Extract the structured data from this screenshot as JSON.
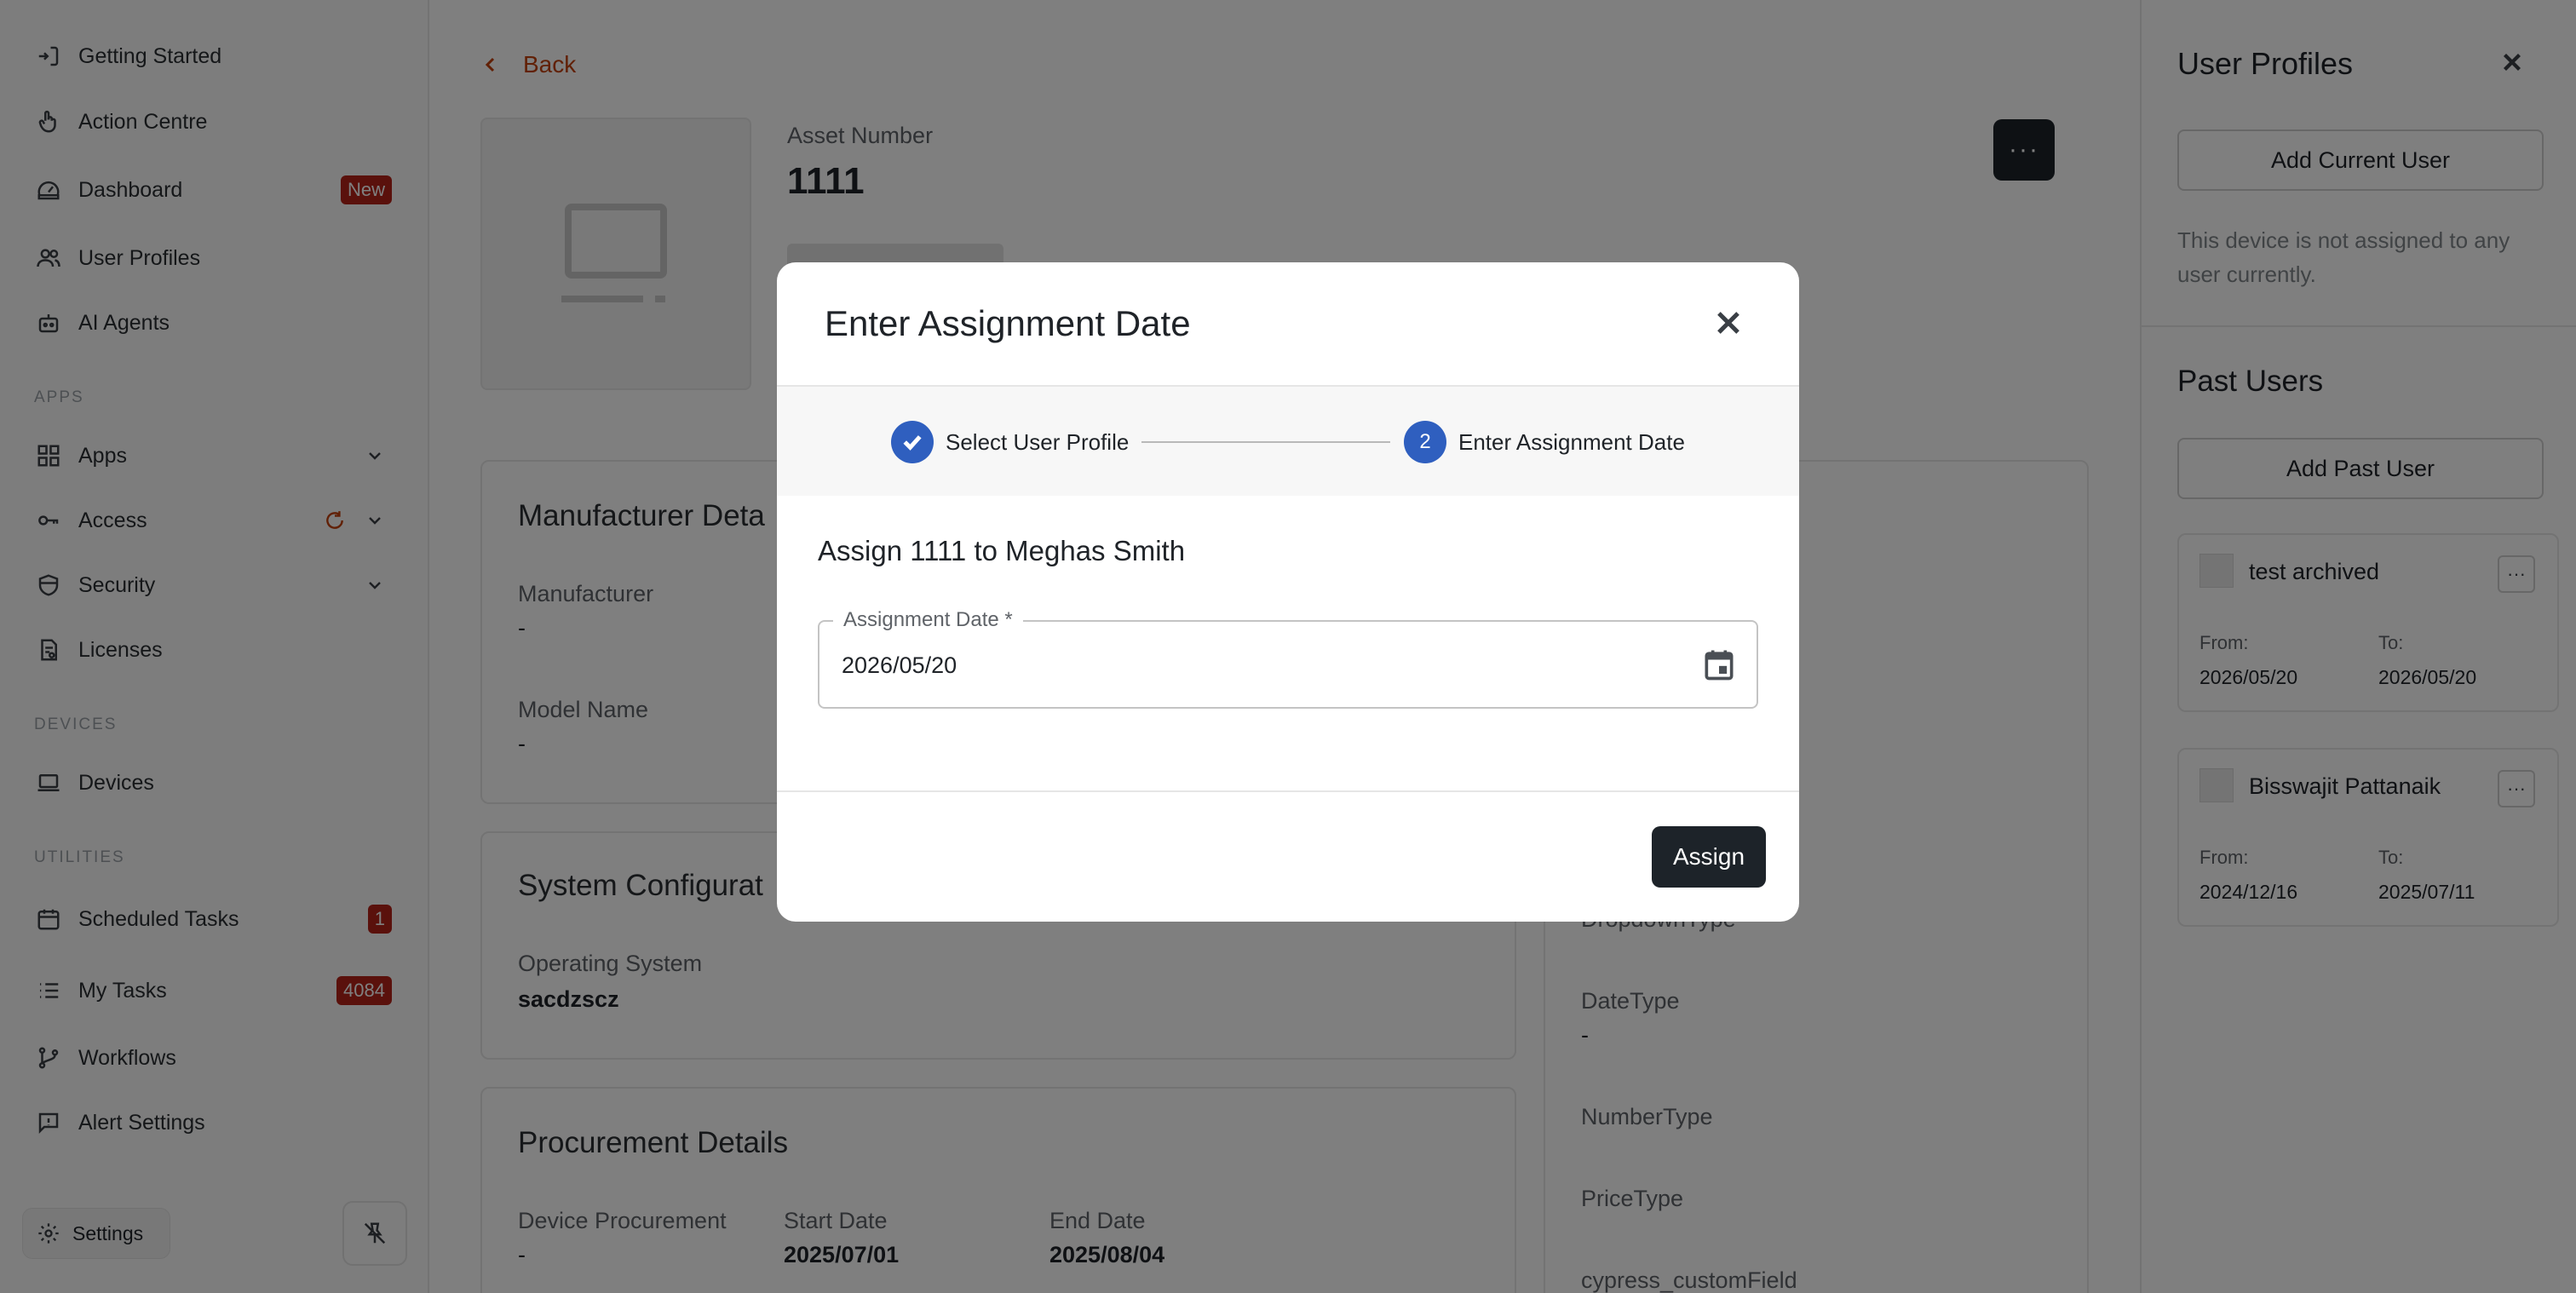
{
  "sidebar": {
    "items": [
      {
        "label": "Getting Started"
      },
      {
        "label": "Action Centre"
      },
      {
        "label": "Dashboard",
        "badge": "New"
      },
      {
        "label": "User Profiles"
      },
      {
        "label": "AI Agents"
      },
      {
        "label": "Apps"
      },
      {
        "label": "Access"
      },
      {
        "label": "Security"
      },
      {
        "label": "Licenses"
      },
      {
        "label": "Devices"
      },
      {
        "label": "Scheduled Tasks",
        "badge": "1"
      },
      {
        "label": "My Tasks",
        "badge": "4084"
      },
      {
        "label": "Workflows"
      },
      {
        "label": "Alert Settings"
      }
    ],
    "sections": {
      "apps": "APPS",
      "devices": "DEVICES",
      "utilities": "UTILITIES"
    },
    "settings_label": "Settings"
  },
  "main": {
    "back_label": "Back",
    "asset_label": "Asset Number",
    "asset_value": "1111",
    "more_label": "···",
    "manufacturer": {
      "title": "Manufacturer Deta",
      "manufacturer_label": "Manufacturer",
      "manufacturer_value": "-",
      "model_label": "Model Name",
      "model_value": "-"
    },
    "system": {
      "title": "System Configurat",
      "os_label": "Operating System",
      "os_value": "sacdzscz"
    },
    "procurement": {
      "title": "Procurement Details",
      "device_label": "Device Procurement",
      "device_value": "-",
      "start_label": "Start Date",
      "start_value": "2025/07/01",
      "end_label": "End Date",
      "end_value": "2025/08/04"
    },
    "custom": {
      "dropdown_label": "DropdownType",
      "date_label": "DateType",
      "date_value": "-",
      "number_label": "NumberType",
      "price_label": "PriceType",
      "cypress_label": "cypress_customField"
    }
  },
  "right_panel": {
    "title": "User Profiles",
    "add_current_label": "Add Current User",
    "note": "This device is not assigned to any user currently.",
    "past_title": "Past Users",
    "add_past_label": "Add Past User",
    "past_users": [
      {
        "name": "test archived",
        "from_label": "From:",
        "from": "2026/05/20",
        "to_label": "To:",
        "to": "2026/05/20"
      },
      {
        "name": "Bisswajit Pattanaik",
        "from_label": "From:",
        "from": "2024/12/16",
        "to_label": "To:",
        "to": "2025/07/11"
      }
    ],
    "more_label": "···"
  },
  "modal": {
    "title": "Enter Assignment Date",
    "steps": [
      {
        "label": "Select User Profile",
        "state": "done"
      },
      {
        "number": "2",
        "label": "Enter Assignment Date",
        "state": "active"
      }
    ],
    "heading": "Assign 1111 to Meghas Smith",
    "field_label": "Assignment Date *",
    "field_value": "2026/05/20",
    "assign_label": "Assign",
    "accent_color": "#2f5fbf"
  },
  "colors": {
    "brand_orange": "#c2410c",
    "badge_red": "#b42318",
    "dark_button": "#1d2329"
  }
}
